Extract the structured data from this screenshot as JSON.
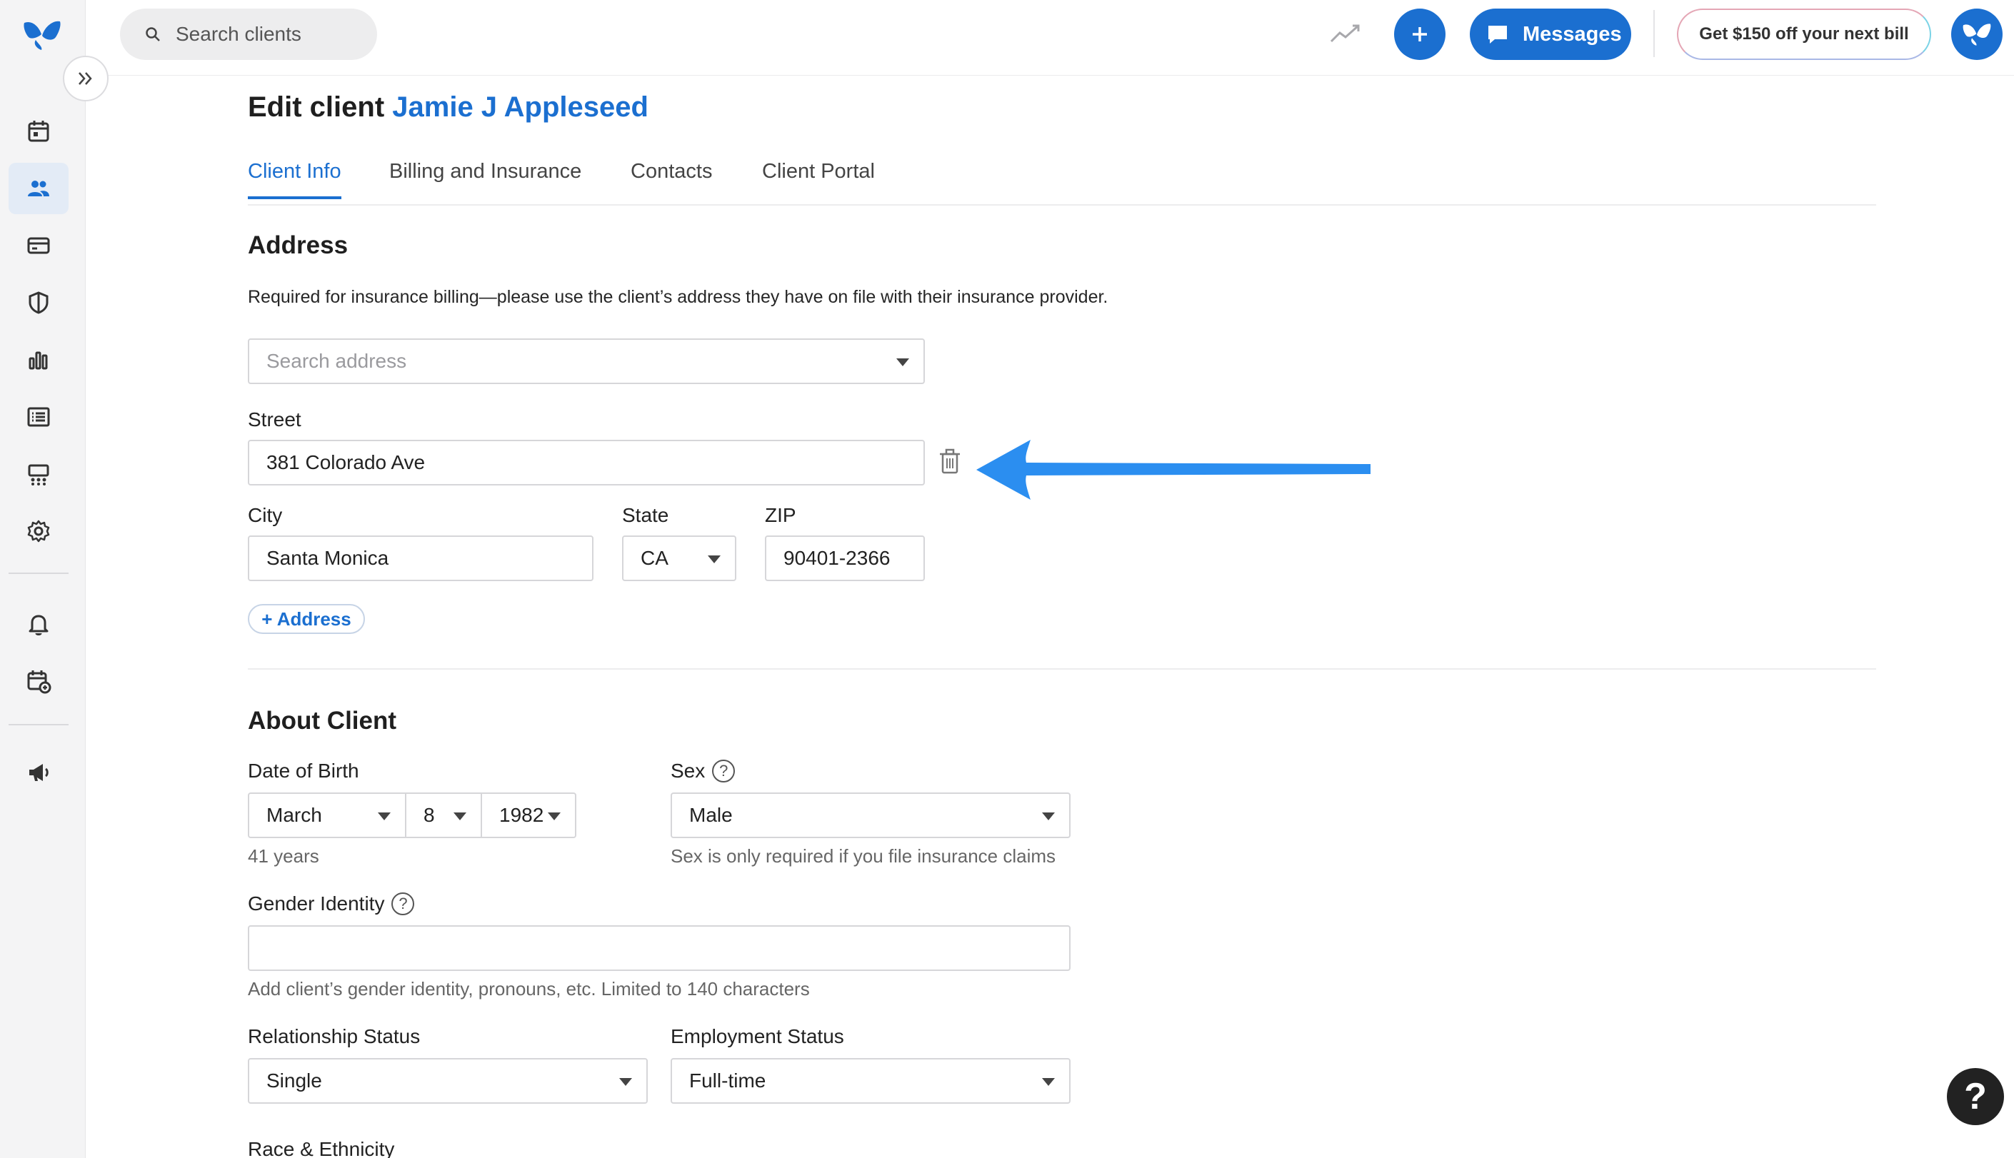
{
  "app": {
    "brand_color": "#1b6fd0"
  },
  "topbar": {
    "search_placeholder": "Search clients",
    "messages_label": "Messages",
    "promo_label": "Get $150 off your next bill"
  },
  "page": {
    "title_prefix": "Edit client",
    "client_name": "Jamie J Appleseed"
  },
  "tabs": [
    {
      "label": "Client Info",
      "active": true
    },
    {
      "label": "Billing and Insurance",
      "active": false
    },
    {
      "label": "Contacts",
      "active": false
    },
    {
      "label": "Client Portal",
      "active": false
    }
  ],
  "address": {
    "heading": "Address",
    "description": "Required for insurance billing—please use the client’s address they have on file with their insurance provider.",
    "search_placeholder": "Search address",
    "street_label": "Street",
    "street_value": "381 Colorado Ave",
    "city_label": "City",
    "city_value": "Santa Monica",
    "state_label": "State",
    "state_value": "CA",
    "zip_label": "ZIP",
    "zip_value": "90401-2366",
    "add_address_label": "+ Address"
  },
  "about": {
    "heading": "About Client",
    "dob_label": "Date of Birth",
    "dob_month": "March",
    "dob_day": "8",
    "dob_year": "1982",
    "age_text": "41 years",
    "sex_label": "Sex",
    "sex_value": "Male",
    "sex_hint": "Sex is only required if you file insurance claims",
    "gender_label": "Gender Identity",
    "gender_value": "",
    "gender_hint": "Add client’s gender identity, pronouns, etc. Limited to 140 characters",
    "relationship_label": "Relationship Status",
    "relationship_value": "Single",
    "employment_label": "Employment Status",
    "employment_value": "Full-time",
    "race_label": "Race & Ethnicity"
  },
  "help_fab_label": "?",
  "help_icon_label": "?"
}
